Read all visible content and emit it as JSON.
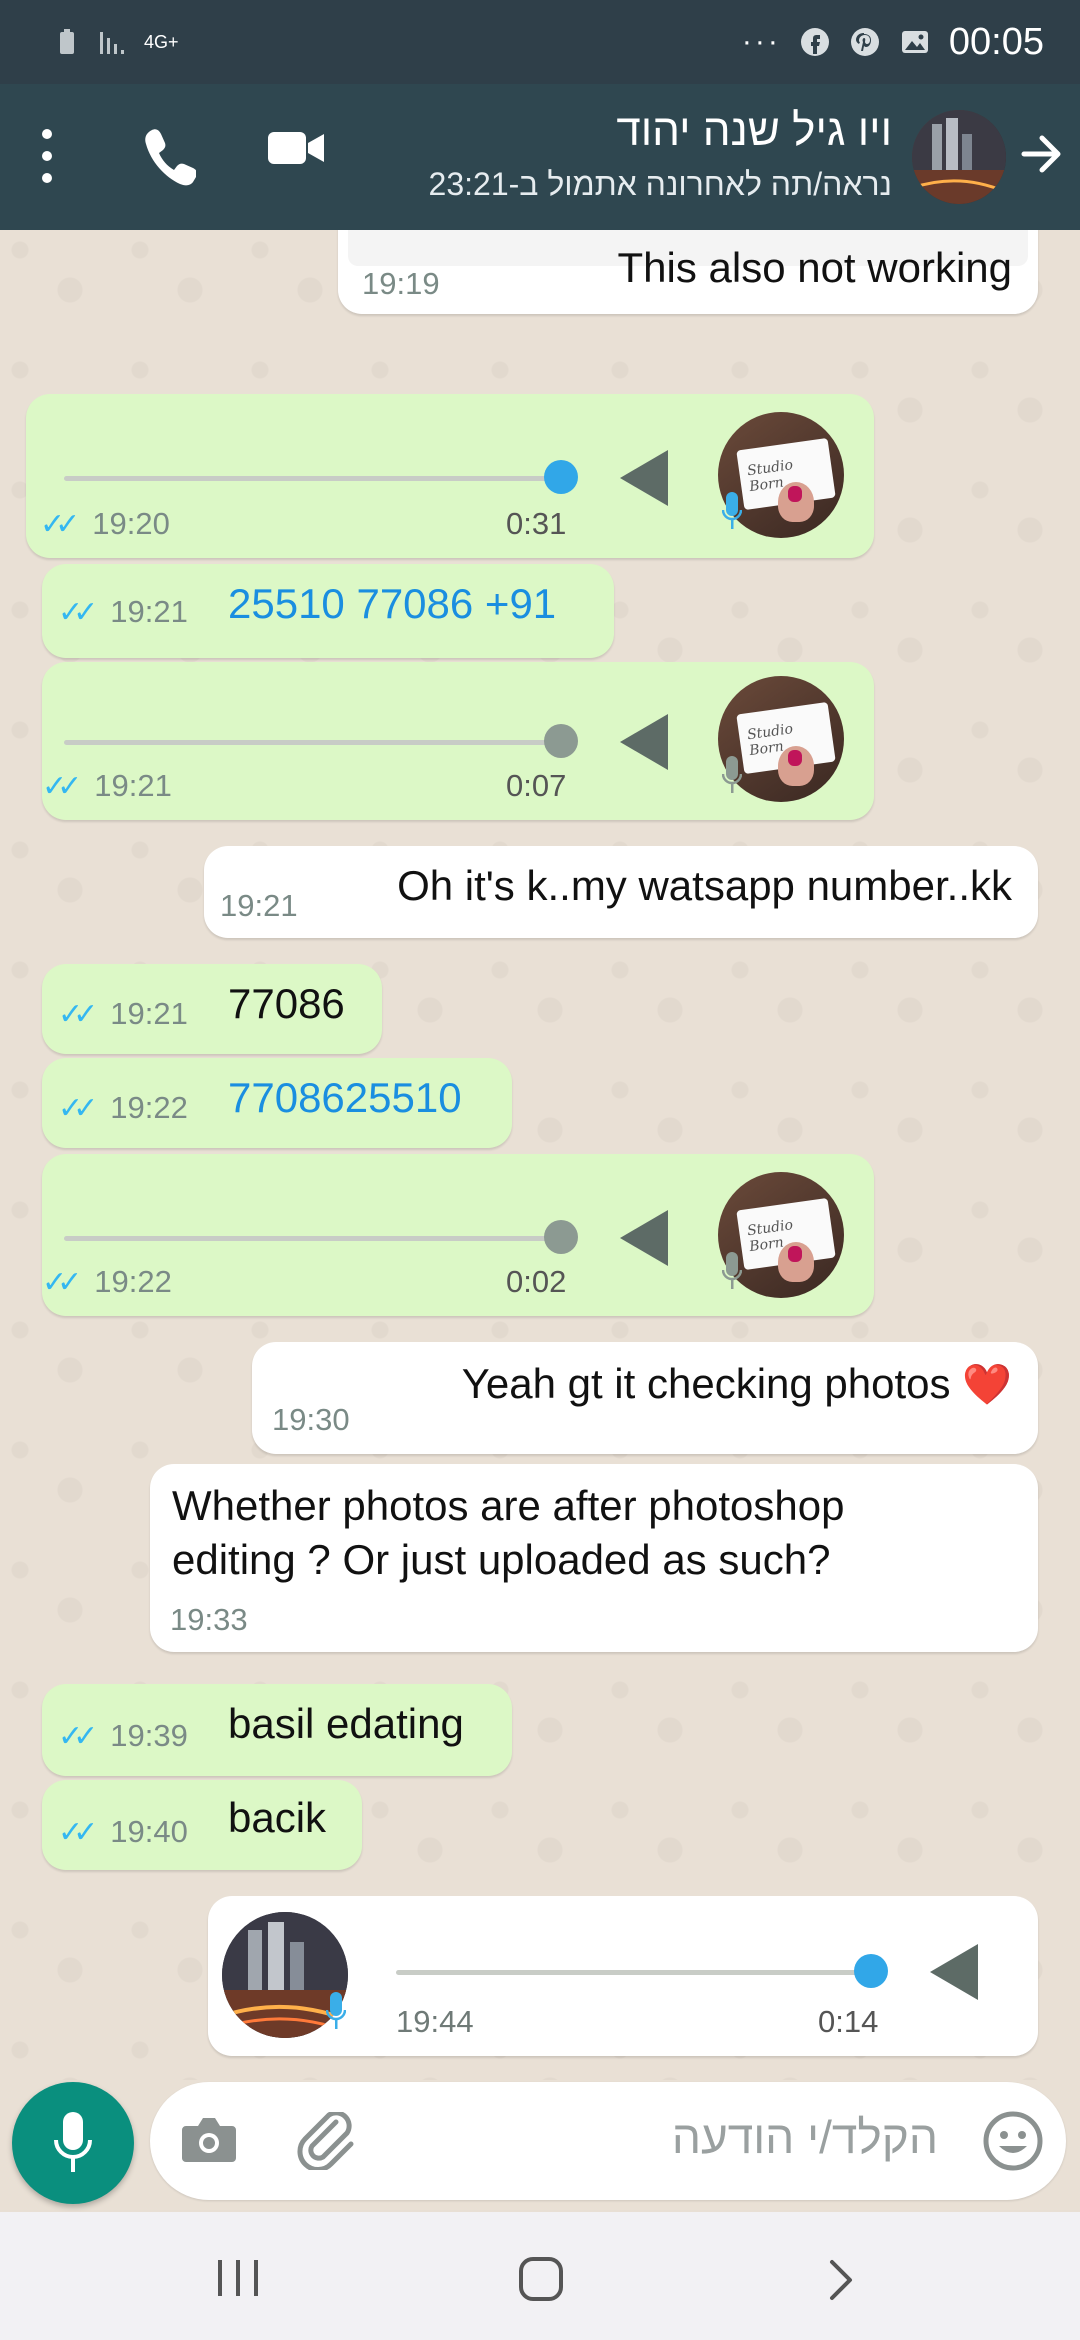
{
  "status_bar": {
    "network": "4G+",
    "overflow": "···",
    "time": "00:05",
    "icons": [
      "battery-icon",
      "signal-icon",
      "facebook-icon",
      "pinterest-icon",
      "gallery-icon"
    ]
  },
  "header": {
    "contact_name": "ויו גיל שנה יהוד",
    "last_seen": "נראה/תה לאחרונה אתמול ב-23:21",
    "icons": [
      "menu-icon",
      "call-icon",
      "video-call-icon",
      "avatar",
      "back-arrow-icon"
    ]
  },
  "messages": [
    {
      "dir": "in",
      "type": "text",
      "text": "This also not working",
      "time": "19:19"
    },
    {
      "dir": "out",
      "type": "voice",
      "duration": "0:31",
      "time": "19:20",
      "progress": 1.0
    },
    {
      "dir": "out",
      "type": "text",
      "text": "25510 77086 +91",
      "time": "19:21",
      "link": true
    },
    {
      "dir": "out",
      "type": "voice",
      "duration": "0:07",
      "time": "19:21",
      "progress": 1.0
    },
    {
      "dir": "in",
      "type": "text",
      "text": "Oh it's k..my watsapp number..kk",
      "time": "19:21"
    },
    {
      "dir": "out",
      "type": "text",
      "text": "77086",
      "time": "19:21"
    },
    {
      "dir": "out",
      "type": "text",
      "text": "7708625510",
      "time": "19:22",
      "link": true
    },
    {
      "dir": "out",
      "type": "voice",
      "duration": "0:02",
      "time": "19:22",
      "progress": 1.0
    },
    {
      "dir": "in",
      "type": "text",
      "text": "Yeah gt it checking photos",
      "emoji": "❤️",
      "time": "19:30"
    },
    {
      "dir": "in",
      "type": "text",
      "text_line1": "Whether photos are after photoshop",
      "text_line2": "editing ? Or just uploaded as such?",
      "time": "19:33"
    },
    {
      "dir": "out",
      "type": "text",
      "text": "basil edating",
      "time": "19:39"
    },
    {
      "dir": "out",
      "type": "text",
      "text": "bacik",
      "time": "19:40"
    },
    {
      "dir": "in",
      "type": "voice",
      "duration": "0:14",
      "time": "19:44",
      "progress": 1.0
    }
  ],
  "avatar_card_text": "Studio Born",
  "composer": {
    "placeholder": "הקלד/י הודעה"
  },
  "colors": {
    "header": "#2f4750",
    "status_bar": "#2f3f49",
    "outgoing_bubble": "#dcf8c6",
    "incoming_bubble": "#ffffff",
    "link": "#1a8ee0",
    "read_ticks": "#34b7f1",
    "fab": "#0a8f7e"
  }
}
